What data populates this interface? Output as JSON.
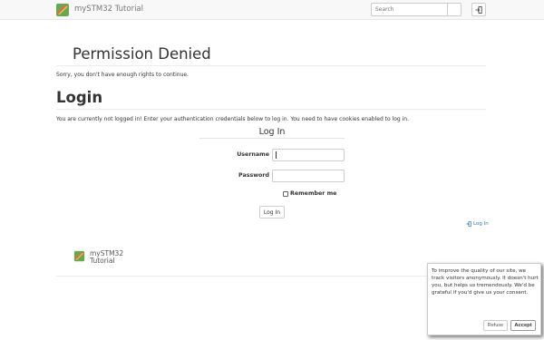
{
  "navbar": {
    "brand": "mySTM32 Tutorial",
    "search_placeholder": "Search"
  },
  "permission": {
    "title": "Permission Denied",
    "message": "Sorry, you don't have enough rights to continue."
  },
  "login": {
    "title": "Login",
    "notice": "You are currently not logged in! Enter your authentication credentials below to log in. You need to have cookies enabled to log in.",
    "form_legend": "Log In",
    "username_label": "Username",
    "password_label": "Password",
    "remember_label": "Remember me",
    "submit_label": "Log In",
    "small_login_link": "Log In"
  },
  "footer": {
    "brand_line1": "mySTM32",
    "brand_line2": "Tutorial"
  },
  "cookie": {
    "text": "To improve the quality of our site, we track visitors anonymously. It doesn't hurt you, but helps us tremendously. We'd be grateful if you'd give us your consent.",
    "refuse_label": "Refuse",
    "accept_label": "Accept"
  }
}
